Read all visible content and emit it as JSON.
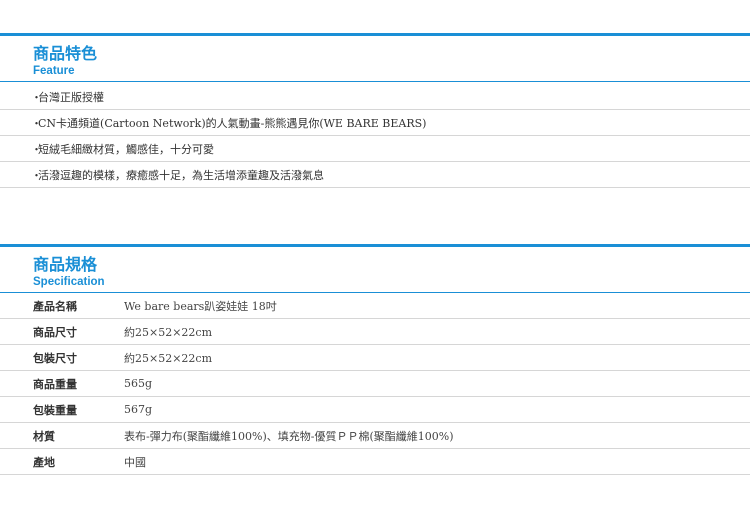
{
  "features": {
    "title": "商品特色",
    "subtitle": "Feature",
    "bullet": "・",
    "items": [
      "台灣正版授權",
      "CN卡通頻道(Cartoon Network)的人氣動畫-熊熊遇見你(WE BARE BEARS)",
      "短絨毛細緻材質，觸感佳，十分可愛",
      "活潑逗趣的模樣，療癒感十足，為生活增添童趣及活潑氣息"
    ]
  },
  "specs": {
    "title": "商品規格",
    "subtitle": "Specification",
    "rows": [
      {
        "label": "產品名稱",
        "value": "We bare bears趴姿娃娃 18吋"
      },
      {
        "label": "商品尺寸",
        "value": "約25×52×22cm"
      },
      {
        "label": "包裝尺寸",
        "value": "約25×52×22cm"
      },
      {
        "label": "商品重量",
        "value": "565g"
      },
      {
        "label": "包裝重量",
        "value": "567g"
      },
      {
        "label": "材質",
        "value": "表布-彈力布(聚酯纖維100%)、填充物-優質ＰＰ棉(聚酯纖維100%)"
      },
      {
        "label": "產地",
        "value": "中國"
      }
    ]
  },
  "colors": {
    "accent": "#1a8fd6",
    "divider": "#d6d6d6"
  }
}
